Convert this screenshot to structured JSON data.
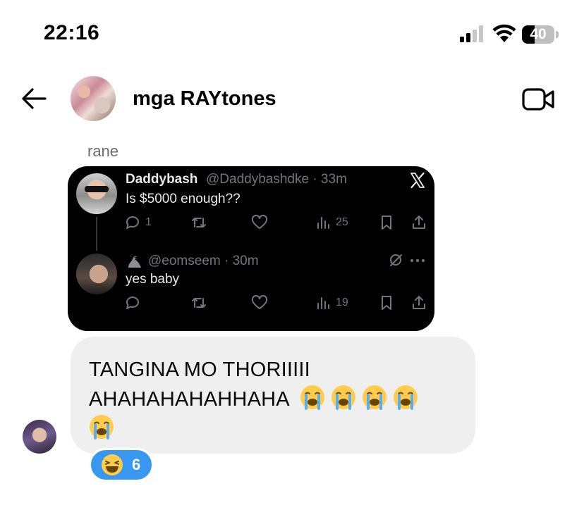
{
  "status_bar": {
    "time": "22:16",
    "battery": "40",
    "battery_level": 0.4
  },
  "header": {
    "title": "mga RAYtones"
  },
  "message": {
    "sender": "rane",
    "text_line1": "TANGINA MO THORIIIII",
    "text_line2": "AHAHAHAHAHHAHA",
    "reaction_count": "6"
  },
  "tweet": {
    "post": {
      "name": "Daddybash",
      "handle_time": "@Daddybashdke · 33m",
      "text": "Is $5000 enough??",
      "replies": "1",
      "views": "25"
    },
    "reply": {
      "handle_time": "@eomseem · 30m",
      "text": "yes baby",
      "views": "19"
    }
  },
  "icons": [
    "arrow-left-icon",
    "video-camera-icon",
    "x-logo-icon",
    "reply-icon",
    "retweet-icon",
    "heart-icon",
    "views-icon",
    "bookmark-icon",
    "share-icon",
    "loudly-crying-face-icon",
    "laughing-face-icon"
  ],
  "colors": {
    "reaction_bg": "#3897f0",
    "bubble_bg": "#efefef",
    "tweet_bg": "#000000"
  }
}
